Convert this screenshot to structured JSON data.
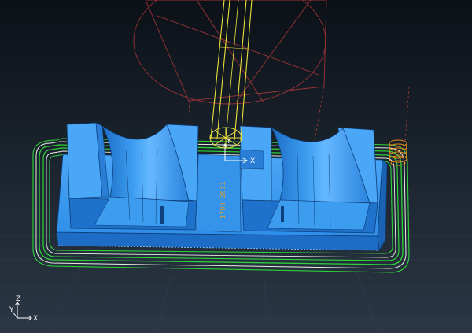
{
  "viewport": {
    "background_top": "#0c1118",
    "background_bottom": "#2a3644",
    "grid_color": "#3b4858"
  },
  "colors": {
    "part_blue": "#2f8ee8",
    "part_light": "#5cb3ff",
    "part_dark": "#1a63b4",
    "part_edge": "#0d3d78",
    "toolpath_green": "#2fd23a",
    "toolpath_white": "#e9f2e6",
    "tool_yellow": "#e8e23a",
    "wire_red": "#b23a3a",
    "engrave_orange": "#e8a228",
    "marker_orange": "#e58a1e",
    "axis_white": "#ffffff"
  },
  "workplane": {
    "x_label": "X",
    "y_label": "Y"
  },
  "view_triad": {
    "z_label": "Z",
    "x_label": "X",
    "y_label": "Y"
  },
  "engraving": {
    "text": "1709 2011"
  },
  "icons": {
    "tool_holder": "tool-holder-wireframe-icon",
    "cutter": "cutter-tool-icon",
    "tool_tip": "tool-tip-circle-icon",
    "workplane_axes": "workplane-axes-icon",
    "view_triad": "view-triad-icon",
    "start_marker": "toolpath-start-marker-icon"
  }
}
